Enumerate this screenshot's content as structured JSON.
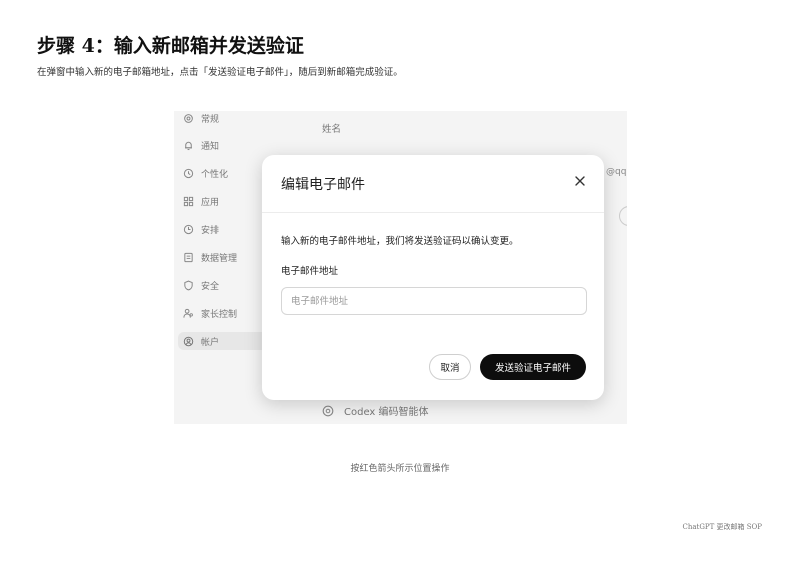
{
  "step": {
    "title": "步骤 4：输入新邮箱并发送验证",
    "description": "在弹窗中输入新的电子邮箱地址，点击「发送验证电子邮件」，随后到新邮箱完成验证。"
  },
  "settings_sidebar": {
    "items": [
      {
        "label": "常规",
        "icon": "gear-icon"
      },
      {
        "label": "通知",
        "icon": "bell-icon"
      },
      {
        "label": "个性化",
        "icon": "clock-icon"
      },
      {
        "label": "应用",
        "icon": "grid-icon"
      },
      {
        "label": "安排",
        "icon": "schedule-icon"
      },
      {
        "label": "数据管理",
        "icon": "data-icon"
      },
      {
        "label": "安全",
        "icon": "shield-icon"
      },
      {
        "label": "家长控制",
        "icon": "family-icon"
      },
      {
        "label": "帐户",
        "icon": "account-icon",
        "active": true
      }
    ]
  },
  "background": {
    "name_label": "姓名",
    "email_fragment": "@qq",
    "codex_label": "Codex 编码智能体",
    "codex_icon": "codex-icon"
  },
  "modal": {
    "title": "编辑电子邮件",
    "close_icon": "close-icon",
    "description": "输入新的电子邮件地址，我们将发送验证码以确认变更。",
    "field_label": "电子邮件地址",
    "input_value": "",
    "input_placeholder": "电子邮件地址",
    "cancel_label": "取消",
    "send_label": "发送验证电子邮件"
  },
  "caption": "按红色箭头所示位置操作",
  "footer": "ChatGPT 更改邮箱 SOP",
  "colors": {
    "primary_button": "#0d0d0d",
    "panel_background": "#f4f4f4",
    "active_item": "#e7e7e7"
  }
}
